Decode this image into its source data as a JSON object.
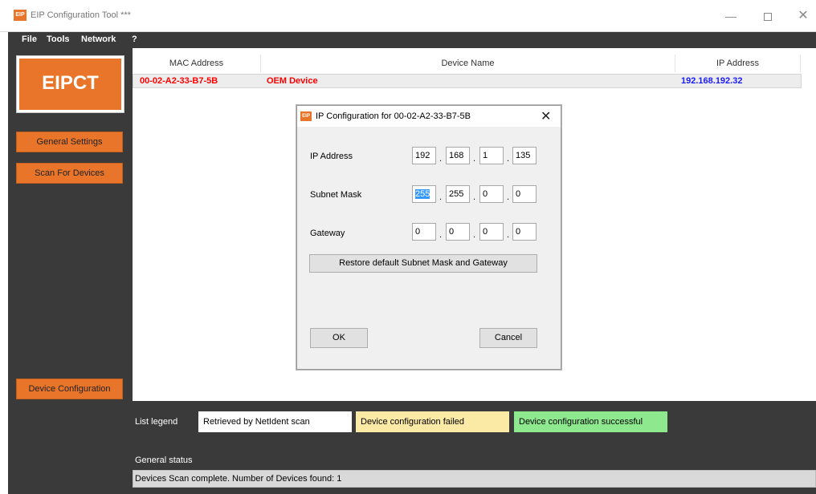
{
  "window": {
    "icon_text": "EIP",
    "title": "EIP Configuration Tool ***",
    "minimize_glyph": "—",
    "close_glyph": "✕"
  },
  "menu": [
    "File",
    "Tools",
    "Network",
    "?"
  ],
  "sidebar": {
    "logo": "EIPCT",
    "buttons": {
      "general_settings": "General Settings",
      "scan_for_devices": "Scan For Devices",
      "device_configuration": "Device Configuration"
    }
  },
  "device_list": {
    "columns": [
      "MAC Address",
      "Device Name",
      "IP Address"
    ],
    "rows": [
      {
        "mac": "00-02-A2-33-B7-5B",
        "name": "OEM Device",
        "ip": "192.168.192.32"
      }
    ]
  },
  "legend": {
    "label": "List legend",
    "items": [
      {
        "text": "Retrieved by NetIdent scan",
        "color": "#ffffff"
      },
      {
        "text": "Device configuration failed",
        "color": "#fbe9a6"
      },
      {
        "text": "Device configuration successful",
        "color": "#8ee88e"
      }
    ]
  },
  "status": {
    "label": "General status",
    "text": "Devices Scan complete. Number of Devices found: 1"
  },
  "dialog": {
    "icon_text": "EIP",
    "title": "IP Configuration for 00-02-A2-33-B7-5B",
    "close_glyph": "✕",
    "ip_label": "IP Address",
    "ip": [
      "192",
      "168",
      "1",
      "135"
    ],
    "subnet_label": "Subnet Mask",
    "subnet": [
      "255",
      "255",
      "0",
      "0"
    ],
    "gateway_label": "Gateway",
    "gateway": [
      "0",
      "0",
      "0",
      "0"
    ],
    "octet_separator": ".",
    "restore_button": "Restore default Subnet Mask and Gateway",
    "ok_button": "OK",
    "cancel_button": "Cancel"
  },
  "colors": {
    "accent": "#e8752a",
    "dark_panel": "#3a3a3a",
    "mac_text": "#ff0000",
    "name_text": "#ff0000",
    "ip_text": "#1a1aff"
  }
}
